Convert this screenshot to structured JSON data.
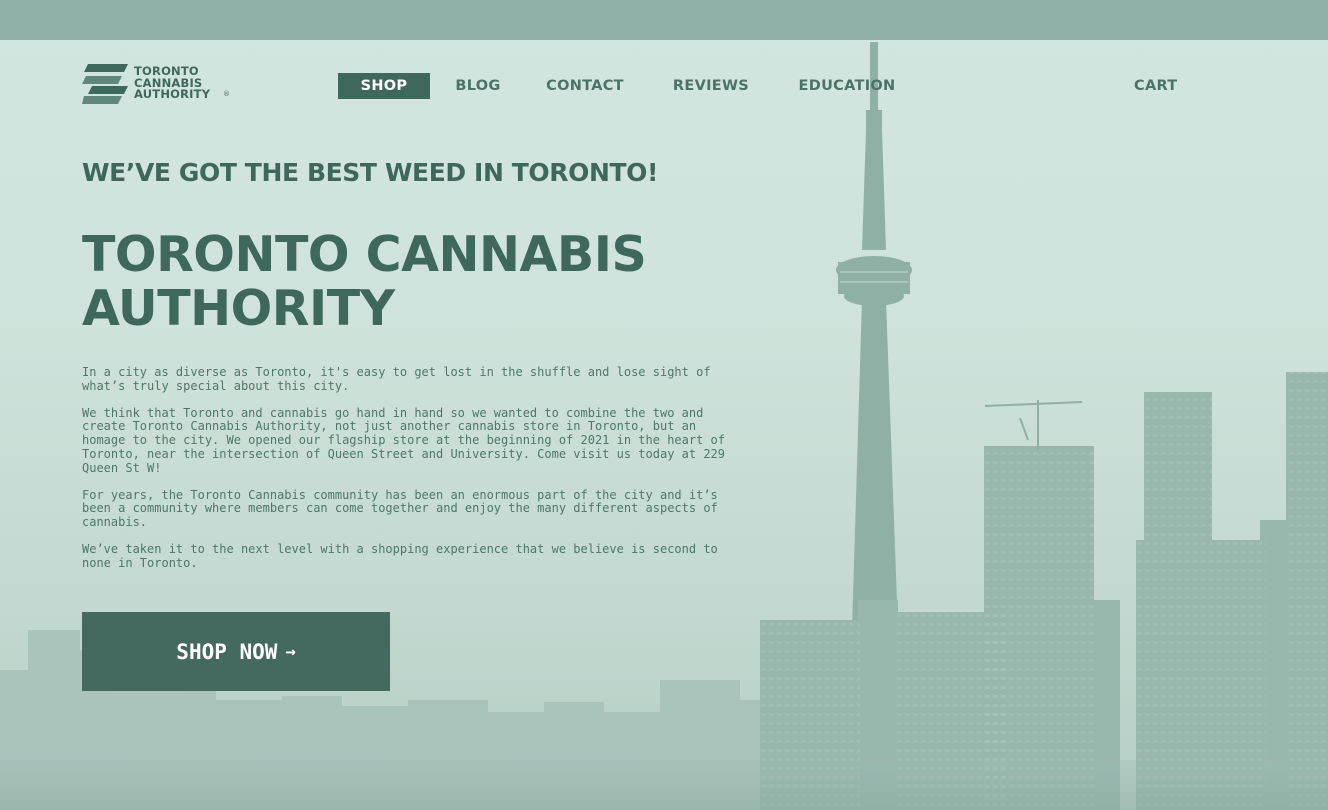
{
  "logo": {
    "lines": [
      "TORONTO",
      "CANNABIS",
      "AUTHORITY"
    ],
    "registered": "®"
  },
  "nav": {
    "items": [
      {
        "label": "SHOP",
        "active": true
      },
      {
        "label": "BLOG",
        "active": false
      },
      {
        "label": "CONTACT",
        "active": false
      },
      {
        "label": "REVIEWS",
        "active": false
      },
      {
        "label": "EDUCATION",
        "active": false
      }
    ],
    "cart_label": "CART"
  },
  "hero": {
    "tagline": "WE’VE GOT THE BEST WEED IN TORONTO!",
    "headline": [
      "TORONTO CANNABIS",
      "AUTHORITY"
    ],
    "paragraphs": [
      "In a city as diverse as Toronto, it's easy to get lost in the shuffle and lose sight of what’s truly special about this city.",
      "We think that Toronto and cannabis go hand in hand so we wanted to combine the two and create Toronto Cannabis Authority, not just another cannabis store in Toronto, but an homage to the city. We opened our flagship store at the beginning of 2021 in the heart of Toronto, near the intersection of Queen Street and University. Come visit us today at 229 Queen St W!",
      "For years, the Toronto Cannabis community has been an enormous part of the city and it’s been a community where members can come together and enjoy the many different aspects of cannabis.",
      "We’ve taken it to the next level with a shopping experience that we believe is second to none in Toronto."
    ],
    "cta_label": "SHOP NOW",
    "cta_icon": "arrow-right-icon"
  },
  "colors": {
    "brand": "#3f685c",
    "background": "#cfe2db",
    "button": "#44695e",
    "top_bar": "#8fb0a6"
  }
}
